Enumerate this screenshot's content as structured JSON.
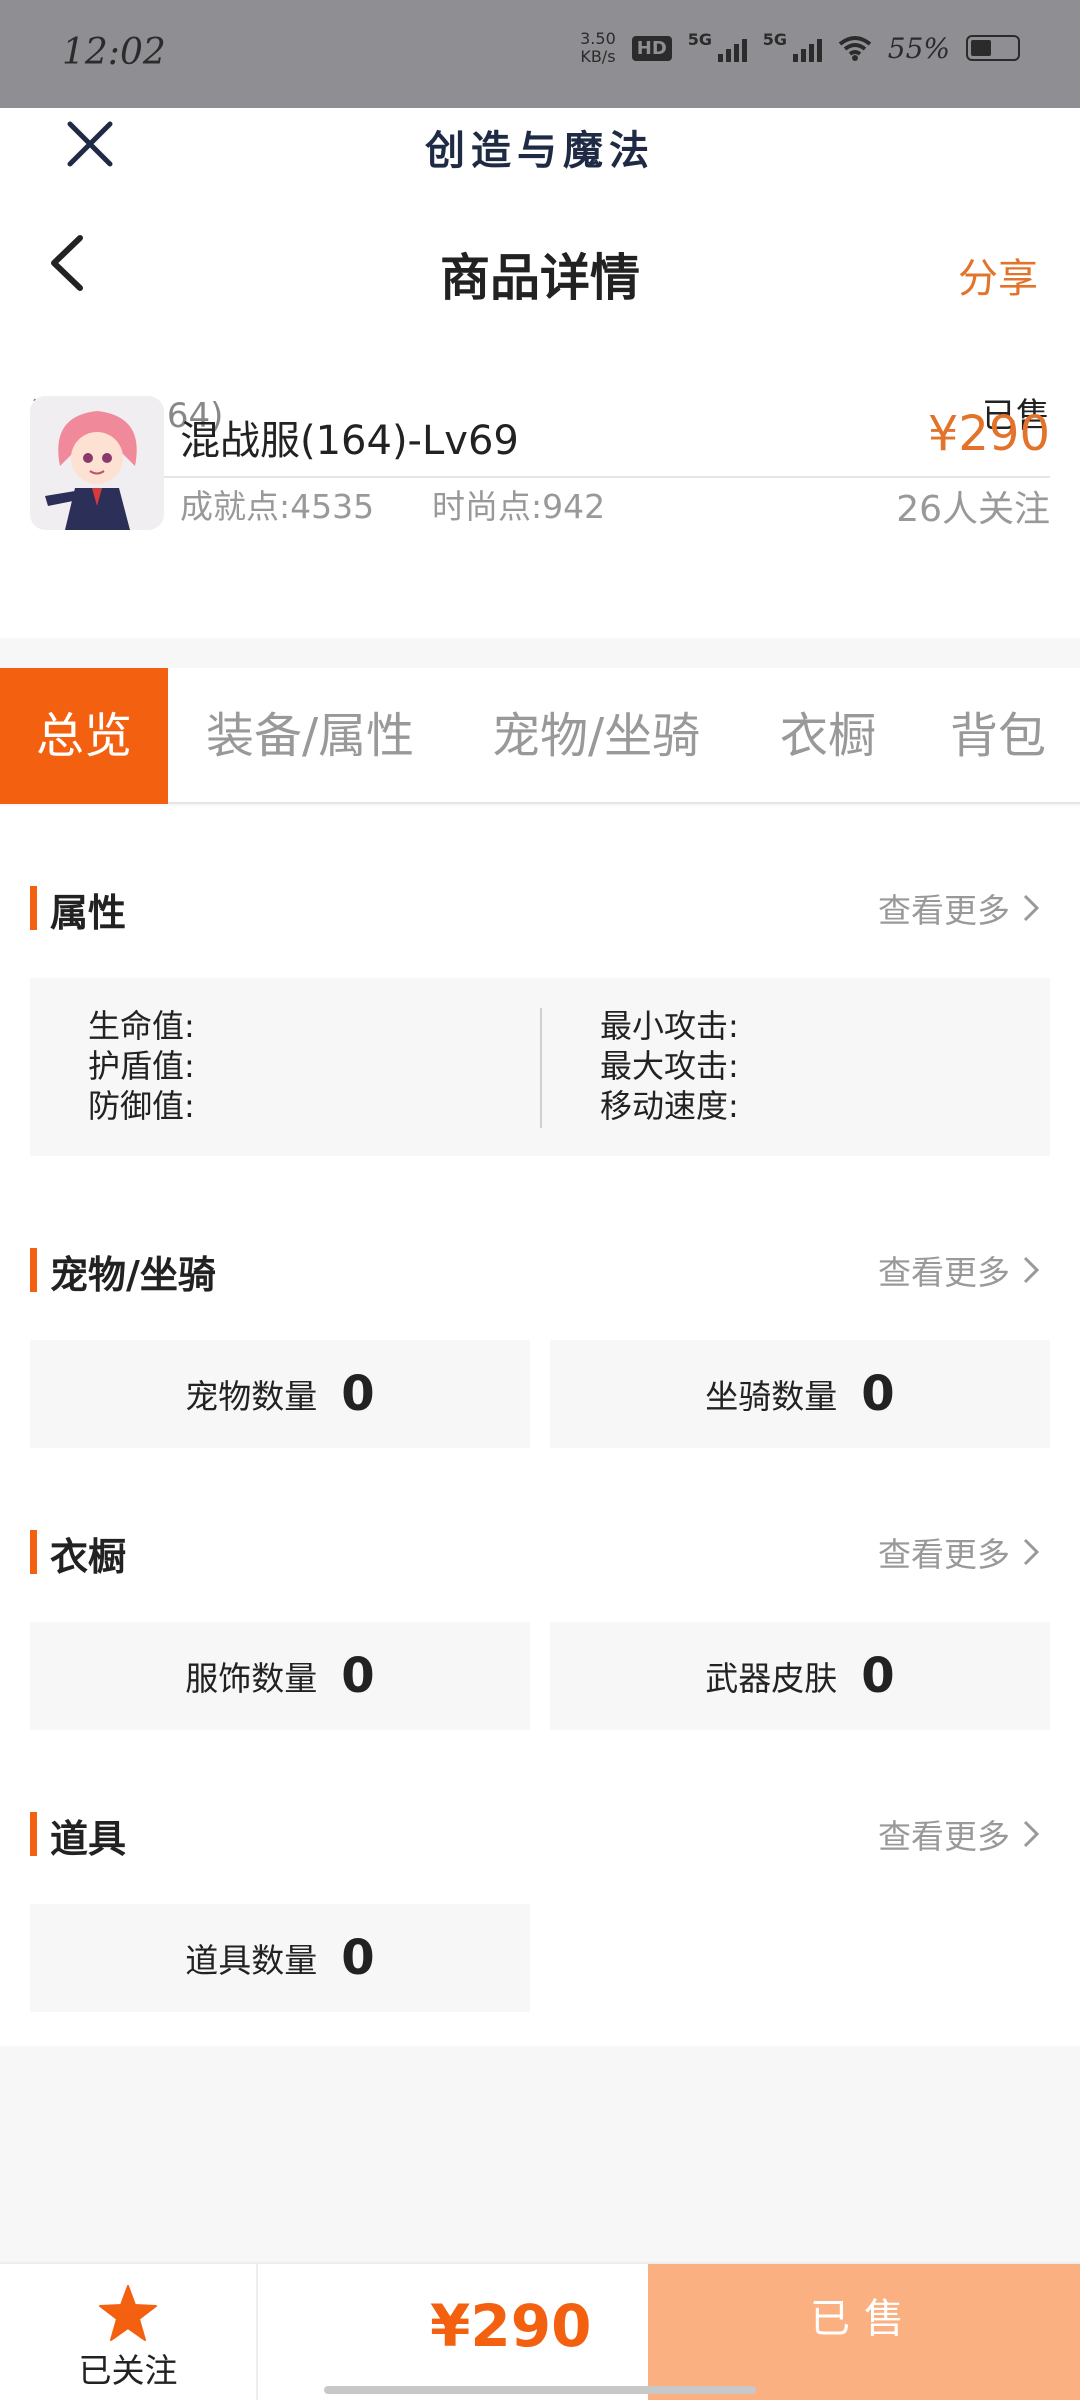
{
  "status_bar": {
    "time": "12:02",
    "net_speed_value": "3.50",
    "net_speed_unit": "KB/s",
    "hd": "HD",
    "signal1": "5G",
    "signal2": "5G",
    "battery": "55%"
  },
  "header": {
    "app_title": "创造与魔法",
    "page_title": "商品详情",
    "share": "分享"
  },
  "product": {
    "server": "混战服(164)",
    "status": "已售",
    "name": "混战服(164)-Lv69",
    "achievement": "成就点:4535",
    "fashion": "时尚点:942",
    "price": "¥290",
    "followers": "26人关注"
  },
  "tabs": [
    "总览",
    "装备/属性",
    "宠物/坐骑",
    "衣橱",
    "背包"
  ],
  "sections": {
    "more_label": "查看更多",
    "attributes": {
      "title": "属性",
      "left": [
        "生命值:",
        "护盾值:",
        "防御值:"
      ],
      "right": [
        "最小攻击:",
        "最大攻击:",
        "移动速度:"
      ]
    },
    "pets": {
      "title": "宠物/坐骑",
      "items": [
        {
          "label": "宠物数量",
          "value": "0"
        },
        {
          "label": "坐骑数量",
          "value": "0"
        }
      ]
    },
    "wardrobe": {
      "title": "衣橱",
      "items": [
        {
          "label": "服饰数量",
          "value": "0"
        },
        {
          "label": "武器皮肤",
          "value": "0"
        }
      ]
    },
    "props": {
      "title": "道具",
      "items": [
        {
          "label": "道具数量",
          "value": "0"
        }
      ]
    }
  },
  "bottom": {
    "follow_label": "已关注",
    "price": "¥290",
    "sold_label": "已售"
  },
  "colors": {
    "accent": "#f3600f",
    "price": "#e3732a",
    "sold_button": "#fbb082"
  },
  "icons": [
    "close-icon",
    "back-icon",
    "chevron-right-icon",
    "star-icon",
    "wifi-icon",
    "battery-icon"
  ]
}
